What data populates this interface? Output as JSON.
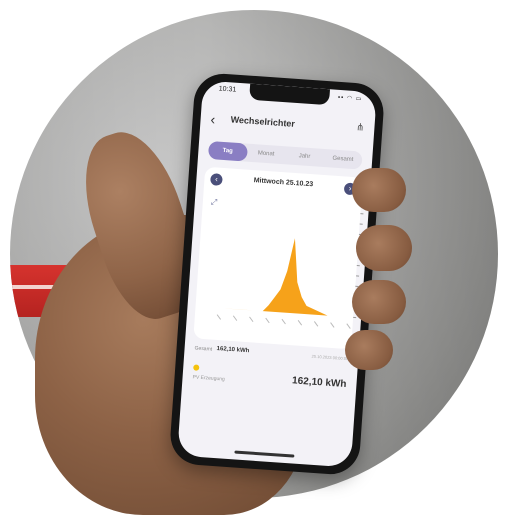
{
  "status": {
    "time": "10:31",
    "icons": "▪▪ ◠ ▭"
  },
  "nav": {
    "back_icon": "chevron-left-icon",
    "title": "Wechselrichter",
    "share_icon": "share-icon"
  },
  "segments": [
    {
      "label": "Tag",
      "active": true
    },
    {
      "label": "Monat",
      "active": false
    },
    {
      "label": "Jahr",
      "active": false
    },
    {
      "label": "Gesamt",
      "active": false
    }
  ],
  "date_nav": {
    "prev": "‹",
    "label": "Mittwoch 25.10.23",
    "next": "›"
  },
  "summary": {
    "label": "Gesamt",
    "value": "162,10 kWh",
    "meta": "25.10.2023 00:00:00"
  },
  "source": {
    "label": "PV Erzeugung",
    "value": "162,10 kWh"
  },
  "colors": {
    "accent": "#8a7ec3",
    "chart_fill": "#f6a21a",
    "button": "#4a4f7a"
  },
  "chart_data": {
    "type": "area",
    "x": [
      0,
      4,
      8,
      9,
      10,
      11,
      12,
      13,
      14,
      15,
      16,
      20,
      24
    ],
    "series": [
      {
        "values": [
          0,
          0,
          0,
          6,
          14,
          22,
          40,
          72,
          30,
          16,
          8,
          0,
          0
        ]
      }
    ],
    "ylim": [
      0,
      100
    ],
    "grid": false
  }
}
